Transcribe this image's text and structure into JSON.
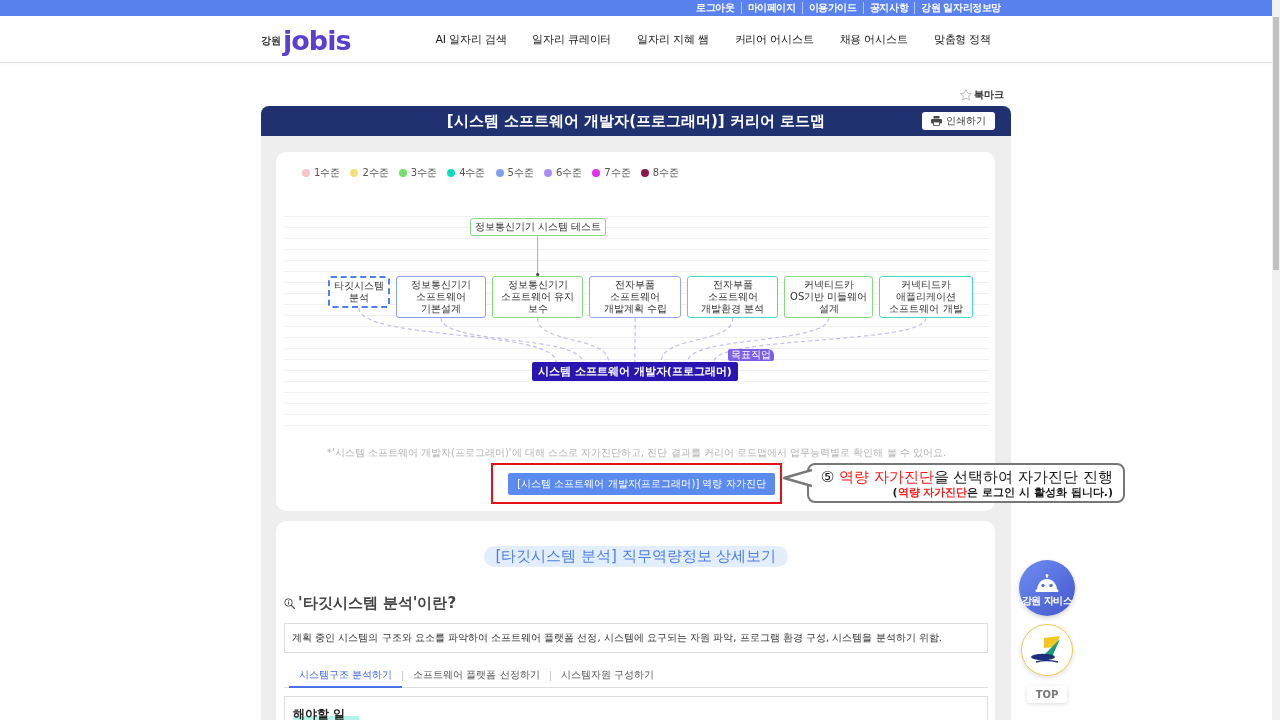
{
  "top_bar": {
    "links": [
      "로그아웃",
      "마이페이지",
      "이용가이드",
      "공지사항",
      "강원 일자리정보망"
    ]
  },
  "header": {
    "logo": {
      "region": "강원",
      "wordmark": "jobis"
    },
    "nav": [
      "AI 일자리 검색",
      "일자리 큐레이터",
      "일자리 지혜 쌤",
      "커리어 어시스트",
      "채용 어시스트",
      "맞춤형 정책"
    ]
  },
  "bookmark": {
    "label": "북마크"
  },
  "roadmap": {
    "title": "[시스템 소프트웨어 개발자(프로그래머)] 커리어 로드맵",
    "print_button": "인쇄하기",
    "legend": [
      {
        "label": "1수준",
        "color": "#f9c3c7"
      },
      {
        "label": "2수준",
        "color": "#f6dd7c"
      },
      {
        "label": "3수준",
        "color": "#6ee06b"
      },
      {
        "label": "4수준",
        "color": "#12d9c4"
      },
      {
        "label": "5수준",
        "color": "#7f9ff2"
      },
      {
        "label": "6수준",
        "color": "#a98cf2"
      },
      {
        "label": "7수준",
        "color": "#e12fea"
      },
      {
        "label": "8수준",
        "color": "#8c1748"
      }
    ],
    "nodes": [
      {
        "label": "타깃시스템 분석",
        "color": "#4f80f0",
        "selected": true
      },
      {
        "label": "정보통신기기 소프트웨어 기본설계",
        "color": "#8a9ef2",
        "selected": false
      },
      {
        "label": "정보통신기기 소프트웨어 유지 보수",
        "color": "#86dd80",
        "selected": false,
        "linked_node": {
          "label": "정보통신기기 시스템 테스트",
          "color": "#86dd80"
        }
      },
      {
        "label": "전자부품 소프트웨어 개발계획 수립",
        "color": "#9aa6ee",
        "selected": false
      },
      {
        "label": "전자부품 소프트웨어 개발환경 분석",
        "color": "#3fdccc",
        "selected": false
      },
      {
        "label": "커넥티드카 OS기반 미들웨어 설계",
        "color": "#86dd80",
        "selected": false
      },
      {
        "label": "커넥티드카 애플리케이션 소프트웨어 개발",
        "color": "#3fdccc",
        "selected": false
      }
    ],
    "target": {
      "label": "시스템 소프트웨어 개발자(프로그래머)",
      "badge": "목표직업"
    },
    "hint": "*'시스템 소프트웨어 개발자(프로그래머)'에 대해 스스로 자가진단하고, 진단 결과를 커리어 로드맵에서 업무능력별로 확인해 볼 수 있어요.",
    "diagnosis_button": "[시스템 소프트웨어 개발자(프로그래머)] 역량 자가진단"
  },
  "callout": {
    "line_1": [
      {
        "text": "⑤ ",
        "emphasis": false
      },
      {
        "text": "역량 자가진단",
        "emphasis": true
      },
      {
        "text": "을 선택하여 자가진단 진행",
        "emphasis": false
      }
    ],
    "line_2": [
      {
        "text": "(",
        "emphasis": false
      },
      {
        "text": "역량 자가진단",
        "emphasis": true
      },
      {
        "text": "은 로그인 시 활성화 됩니다.)",
        "emphasis": false
      }
    ]
  },
  "detail": {
    "heading": "[타깃시스템 분석] 직무역량정보 상세보기",
    "question": "'타깃시스템 분석'이란?",
    "definition": "계획 중인 시스템의 구조와 요소를 파악하여 소프트웨어 플랫폼 선정, 시스템에 요구되는 자원 파악, 프로그램 환경 구성, 시스템을 분석하기 위함.",
    "tabs": [
      {
        "label": "시스템구조 분석하기",
        "selected": true
      },
      {
        "label": "소프트웨어 플랫폼 선정하기",
        "selected": false
      },
      {
        "label": "시스템자원 구성하기",
        "selected": false
      }
    ],
    "task_title": "해야할 일"
  },
  "floating": {
    "assistant": "강원 자비스",
    "top_button": "TOP"
  }
}
